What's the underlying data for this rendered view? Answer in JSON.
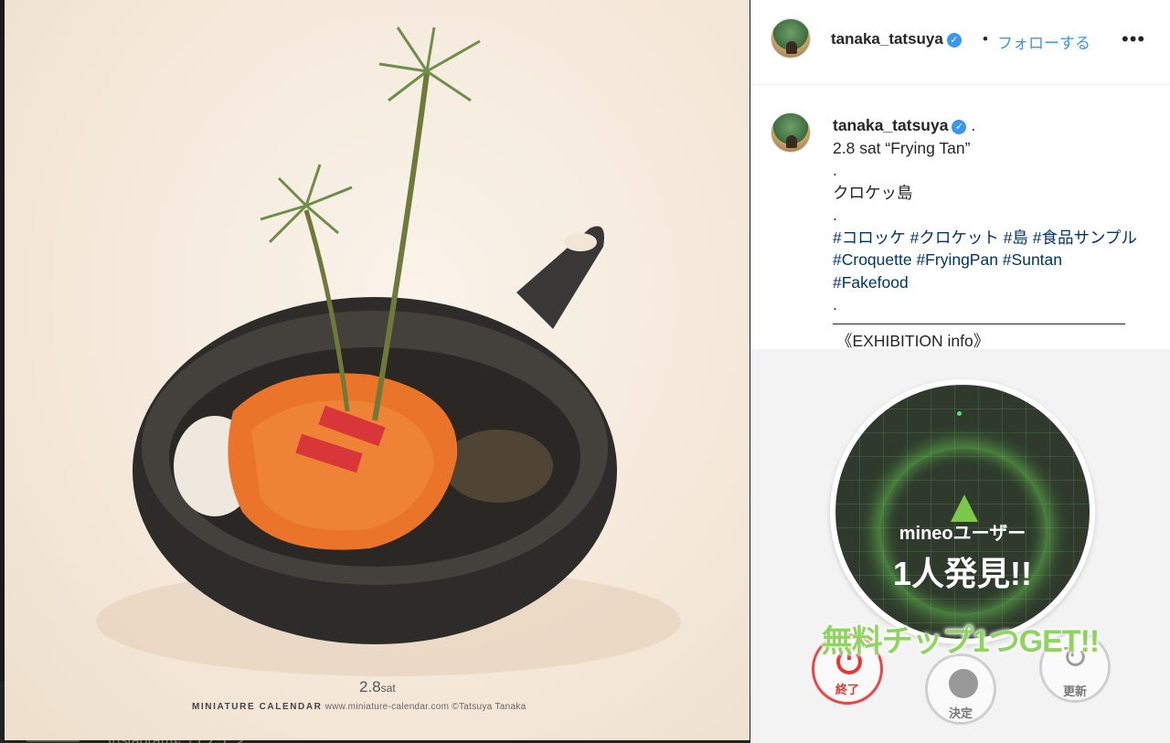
{
  "post": {
    "username": "tanaka_tatsuya",
    "follow_label": "フォローする",
    "more_label": "•••",
    "verified_glyph": "✓",
    "separator": "•"
  },
  "caption": {
    "username": "tanaka_tatsuya",
    "suffix": ".",
    "line1": "2.8 sat “Frying Tan”",
    "dot1": ".",
    "line2": "クロケッ島",
    "dot2": ".",
    "hashtags_1": "#コロッケ #クロケット #島 #食品サンプル",
    "hashtags_2": "#Croquette #FryingPan #Suntan",
    "hashtags_3": "#Fakefood",
    "dot3": ".",
    "exhibition": "《EXHIBITION info》"
  },
  "photo": {
    "date_main": "2.8",
    "date_day": "sat",
    "credit_brand": "MINIATURE CALENDAR",
    "credit_rest": "www.miniature-calendar.com ©Tatsuya Tanaka"
  },
  "mineo": {
    "found_sub": "mineoユーザー",
    "found_main": "1人発見!!",
    "get_text": "無料チップ1つGET!!",
    "end_label": "終了",
    "decide_label": "決定",
    "refresh_label": "更新"
  },
  "backdrop": {
    "text": "Instagramにログイン"
  },
  "colors": {
    "link": "#3897f0",
    "hashtag": "#003569",
    "radar_green": "#8fd460",
    "end_red": "#e33"
  }
}
